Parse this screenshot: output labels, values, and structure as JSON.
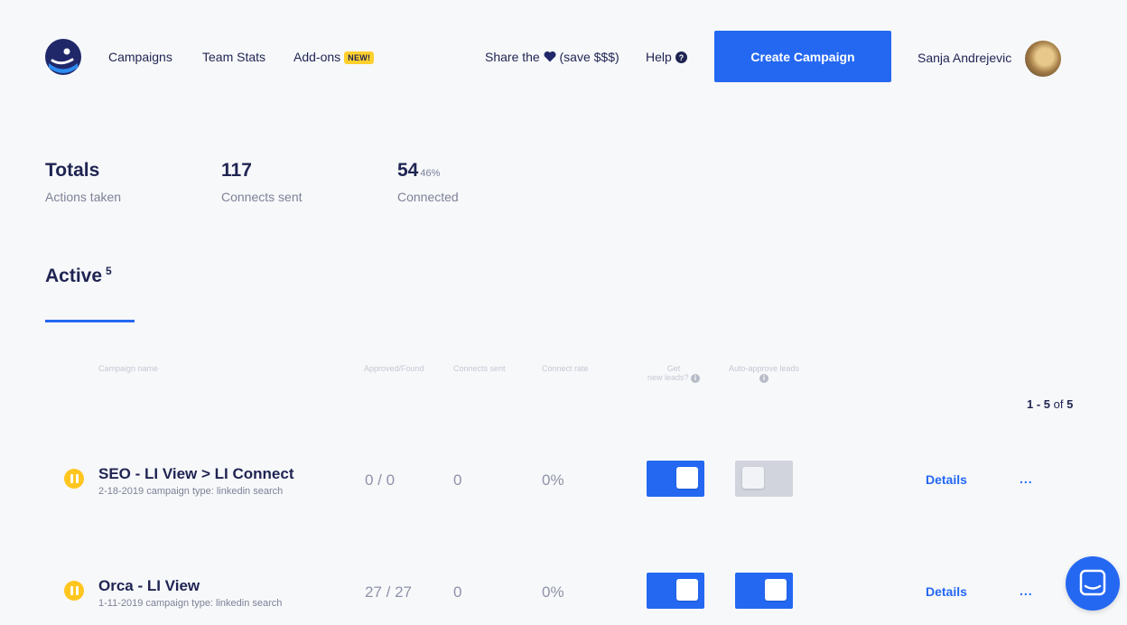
{
  "header": {
    "nav": [
      "Campaigns",
      "Team Stats",
      "Add-ons"
    ],
    "new_badge": "NEW!",
    "share_prefix": "Share the",
    "share_suffix": "(save $$$)",
    "help": "Help",
    "create_button": "Create Campaign",
    "user_name": "Sanja Andrejevic"
  },
  "stats": [
    {
      "value": "Totals",
      "label": "Actions taken"
    },
    {
      "value": "117",
      "label": "Connects sent"
    },
    {
      "value": "54",
      "pct": "46%",
      "label": "Connected"
    }
  ],
  "section": {
    "title": "Active",
    "count": "5"
  },
  "columns": {
    "name": "Campaign name",
    "approved": "Approved/Found",
    "connects": "Connects sent",
    "rate": "Connect rate",
    "new_leads_1": "Get",
    "new_leads_2": "new leads?",
    "auto_approve": "Auto-approve leads"
  },
  "pager": {
    "range": "1 - 5",
    "of": "of",
    "total": "5"
  },
  "rows": [
    {
      "name": "SEO - LI View > LI Connect",
      "subtitle": "2-18-2019 campaign type: linkedin search",
      "approved": "0 / 0",
      "connects": "0",
      "rate": "0%",
      "new_leads": true,
      "auto_approve": false,
      "details": "Details",
      "more": "..."
    },
    {
      "name": "Orca - LI View",
      "subtitle": "1-11-2019 campaign type: linkedin search",
      "approved": "27 / 27",
      "connects": "0",
      "rate": "0%",
      "new_leads": true,
      "auto_approve": true,
      "details": "Details",
      "more": "..."
    }
  ],
  "colors": {
    "accent": "#2468f2",
    "navy": "#1f2452",
    "pause": "#ffc620",
    "badge": "#ffd02e"
  },
  "icons": [
    "logo-icon",
    "heart-icon",
    "help-icon",
    "pause-icon",
    "info-icon",
    "chat-icon"
  ]
}
